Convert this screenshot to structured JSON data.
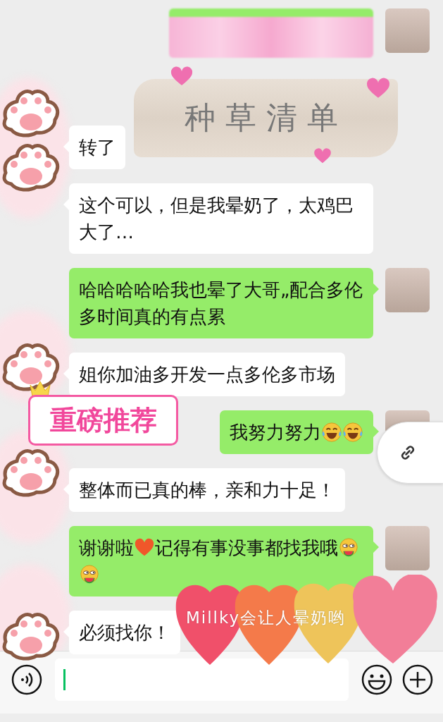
{
  "messages": [
    {
      "kind": "outgoing-blurred"
    },
    {
      "kind": "incoming-text",
      "parts": [
        {
          "kind": "text",
          "text": "转了"
        }
      ]
    },
    {
      "kind": "incoming-text",
      "parts": [
        {
          "kind": "text",
          "text": "这个可以，但是我晕奶了，太鸡巴大了…"
        }
      ]
    },
    {
      "kind": "outgoing-text",
      "parts": [
        {
          "kind": "text",
          "text": "哈哈哈哈哈我也晕了大哥„配合多伦多时间真的有点累"
        }
      ]
    },
    {
      "kind": "incoming-text",
      "parts": [
        {
          "kind": "text",
          "text": "姐你加油多开发一点多伦多市场"
        }
      ]
    },
    {
      "kind": "outgoing-text",
      "parts": [
        {
          "kind": "text",
          "text": "我努力努力"
        },
        {
          "kind": "laugh"
        },
        {
          "kind": "laugh"
        }
      ]
    },
    {
      "kind": "incoming-text",
      "parts": [
        {
          "kind": "text",
          "text": "整体而已真的棒，亲和力十足！"
        }
      ]
    },
    {
      "kind": "outgoing-text",
      "parts": [
        {
          "kind": "text",
          "text": "谢谢啦"
        },
        {
          "kind": "heart"
        },
        {
          "kind": "text",
          "text": "记得有事没事都找我哦"
        },
        {
          "kind": "melon"
        },
        {
          "kind": "melon"
        }
      ]
    },
    {
      "kind": "incoming-text",
      "parts": [
        {
          "kind": "text",
          "text": "必须找你！"
        }
      ]
    }
  ],
  "stickers": [
    {
      "kind": "brush-banner",
      "text": "种草清单"
    },
    {
      "kind": "badge",
      "text": "重磅推荐"
    },
    {
      "kind": "hearts",
      "text": "Millky会让人晕奶哟"
    }
  ]
}
